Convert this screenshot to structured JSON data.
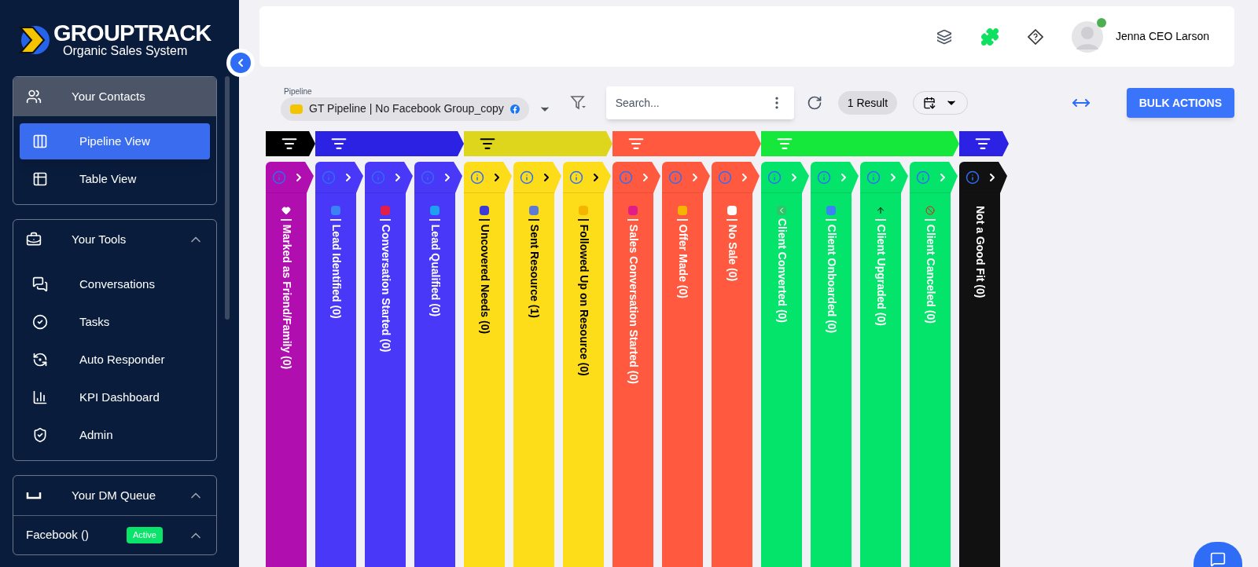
{
  "sidebar": {
    "logo": {
      "name": "GROUPTRACK",
      "tagline": "Organic Sales System"
    },
    "sections": [
      {
        "title": "Your Contacts",
        "selected": true,
        "items": [
          {
            "label": "Pipeline View",
            "selected": true
          },
          {
            "label": "Table View",
            "selected": false
          }
        ]
      },
      {
        "title": "Your Tools",
        "selected": false,
        "expanded": true,
        "items": [
          {
            "label": "Conversations",
            "selected": false
          },
          {
            "label": "Tasks",
            "selected": false
          },
          {
            "label": "Auto Responder",
            "selected": false
          },
          {
            "label": "KPI Dashboard",
            "selected": false
          },
          {
            "label": "Admin",
            "selected": false
          }
        ]
      },
      {
        "title": "Your DM Queue",
        "selected": false,
        "expanded": true,
        "queues": [
          {
            "label": "Facebook ()",
            "badge": "Active",
            "expanded": true
          }
        ]
      }
    ]
  },
  "header": {
    "user": {
      "name": "Jenna CEO Larson",
      "online": true
    }
  },
  "toolbar": {
    "pipeline": {
      "label": "Pipeline",
      "value": "GT Pipeline | No Facebook Group_copy"
    },
    "search": {
      "placeholder": "Search..."
    },
    "result_count": "1 Result",
    "bulk_button": "BULK ACTIONS"
  },
  "groups": [
    {
      "color": "#000000",
      "stages": [
        {
          "title": "| Marked as Friend/Family (0)",
          "color": "#b00eae"
        }
      ]
    },
    {
      "color": "#2b22e4",
      "stages": [
        {
          "title": "| Lead Identified (0)",
          "color": "#4a38f8"
        },
        {
          "title": "| Conversation Started (0)",
          "color": "#4a38f8"
        },
        {
          "title": "| Lead Qualified (0)",
          "color": "#4a38f8"
        }
      ]
    },
    {
      "color": "#ded61c",
      "stages": [
        {
          "title": "| Uncovered Needs (0)",
          "color": "#fddc1a"
        },
        {
          "title": "| Sent Resource (1)",
          "color": "#fddc1a"
        },
        {
          "title": "| Followed Up on Resource (0)",
          "color": "#fddc1a"
        }
      ]
    },
    {
      "color": "#ff5a3f",
      "stages": [
        {
          "title": "| Sales Conversation Started (0)",
          "color": "#ff5a3f"
        },
        {
          "title": "| Offer Made (0)",
          "color": "#ff5a3f"
        },
        {
          "title": "| No Sale (0)",
          "color": "#ff5a3f"
        }
      ]
    },
    {
      "color": "#15e83a",
      "stages": [
        {
          "title": "Client Converted (0)",
          "color": "#05e46a"
        },
        {
          "title": "| Client Onboarded (0)",
          "color": "#05e46a"
        },
        {
          "title": "| Client Upgraded (0)",
          "color": "#05e46a"
        },
        {
          "title": "| Client Canceled (0)",
          "color": "#05e46a"
        }
      ]
    },
    {
      "color": "#2b22e4",
      "stages": [
        {
          "title": "Not a Good Fit (0)",
          "color": "#111111"
        }
      ]
    }
  ]
}
